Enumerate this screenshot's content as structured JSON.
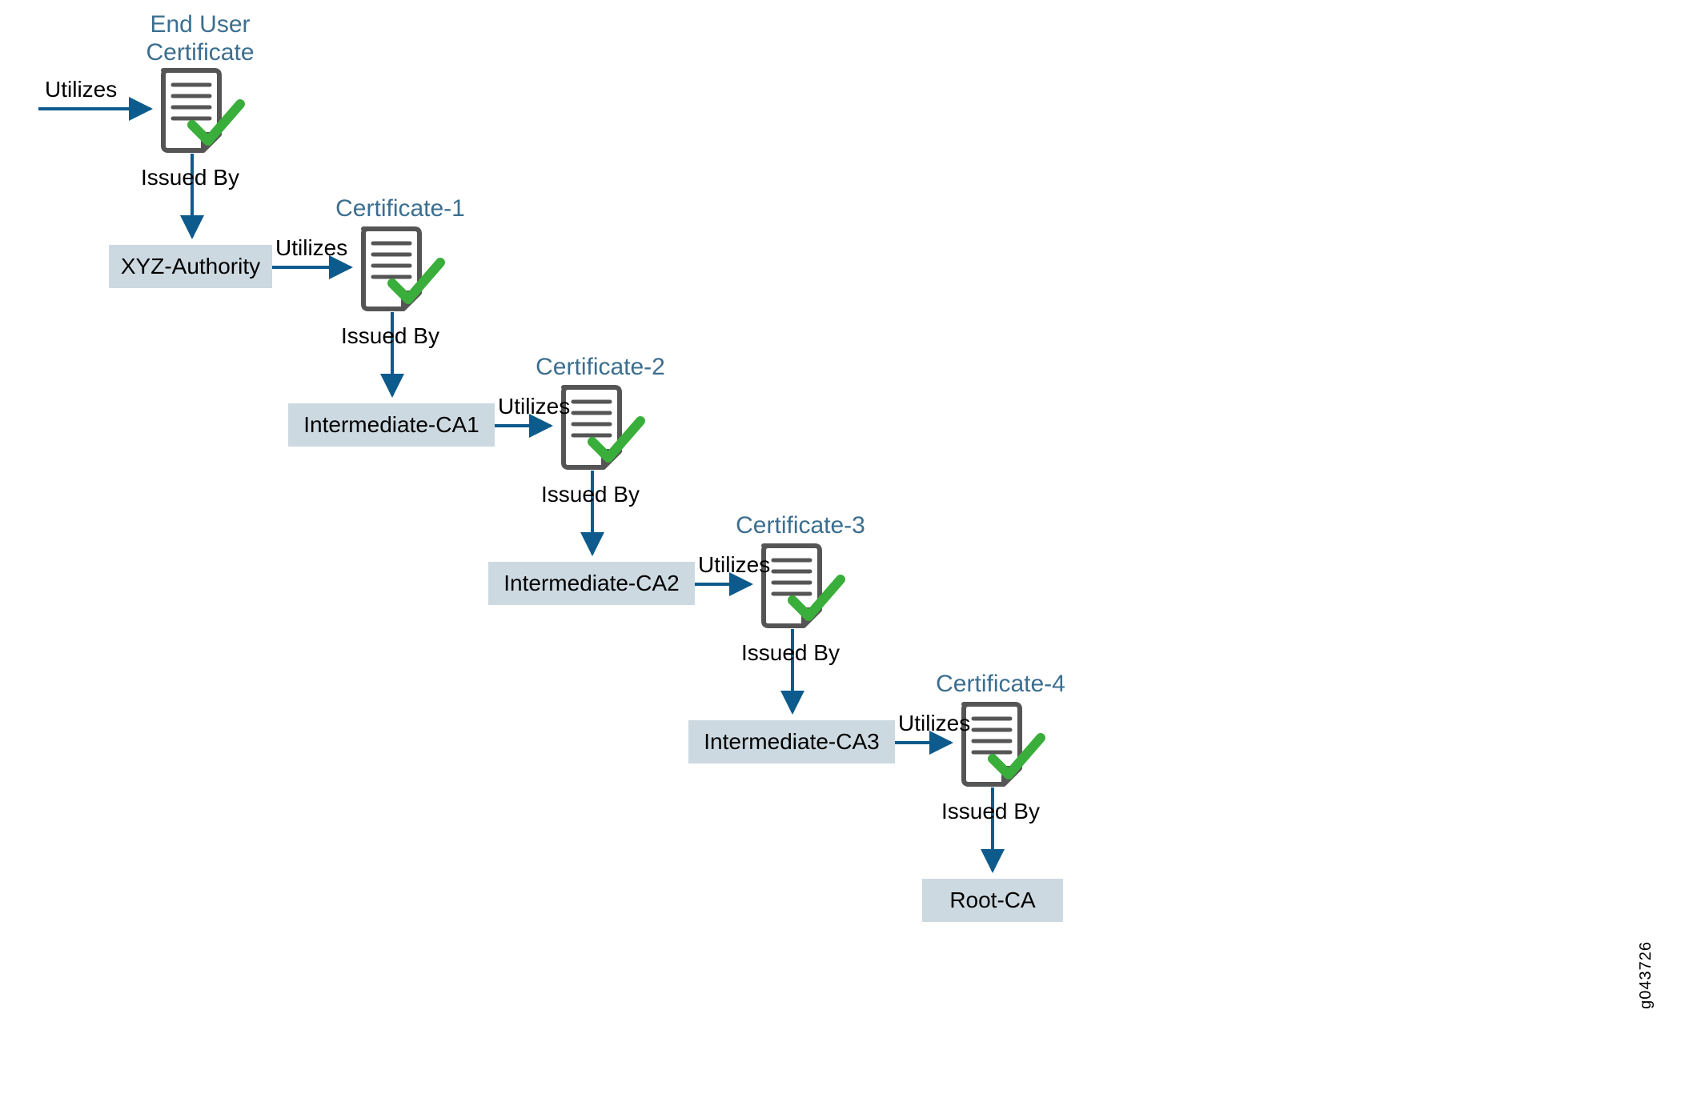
{
  "titles": {
    "cert0": "End User\nCertificate",
    "cert1": "Certificate-1",
    "cert2": "Certificate-2",
    "cert3": "Certificate-3",
    "cert4": "Certificate-4"
  },
  "labels": {
    "utilizes": "Utilizes",
    "issuedBy": "Issued By"
  },
  "boxes": {
    "auth0": "XYZ-Authority",
    "auth1": "Intermediate-CA1",
    "auth2": "Intermediate-CA2",
    "auth3": "Intermediate-CA3",
    "root": "Root-CA"
  },
  "figref": "g043726"
}
